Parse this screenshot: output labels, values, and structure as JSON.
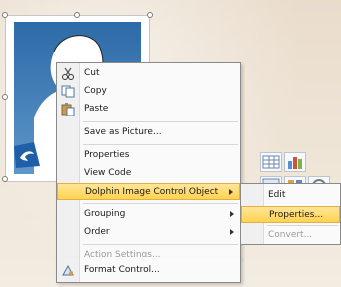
{
  "menu": {
    "items": [
      {
        "label": "Cut",
        "icon": "scissors-icon"
      },
      {
        "label": "Copy",
        "icon": "copy-icon"
      },
      {
        "label": "Paste",
        "icon": "paste-icon"
      },
      {
        "label": "Save as Picture..."
      },
      {
        "label": "Properties"
      },
      {
        "label": "View Code"
      },
      {
        "label": "Dolphin Image Control Object",
        "submenu": true,
        "highlighted": true
      },
      {
        "label": "Grouping",
        "submenu": true
      },
      {
        "label": "Order",
        "submenu": true
      },
      {
        "label": "Action Settings...",
        "disabled": true
      },
      {
        "label": "Format Control...",
        "icon": "format-control-icon"
      }
    ]
  },
  "submenu": {
    "items": [
      {
        "label": "Edit"
      },
      {
        "label": "Properties...",
        "highlighted": true
      },
      {
        "label": "Convert...",
        "disabled": true
      }
    ]
  },
  "colors": {
    "highlight": "#ffd34f",
    "menu_bg": "#fafafa",
    "picture_blue": "#3b79b5"
  }
}
